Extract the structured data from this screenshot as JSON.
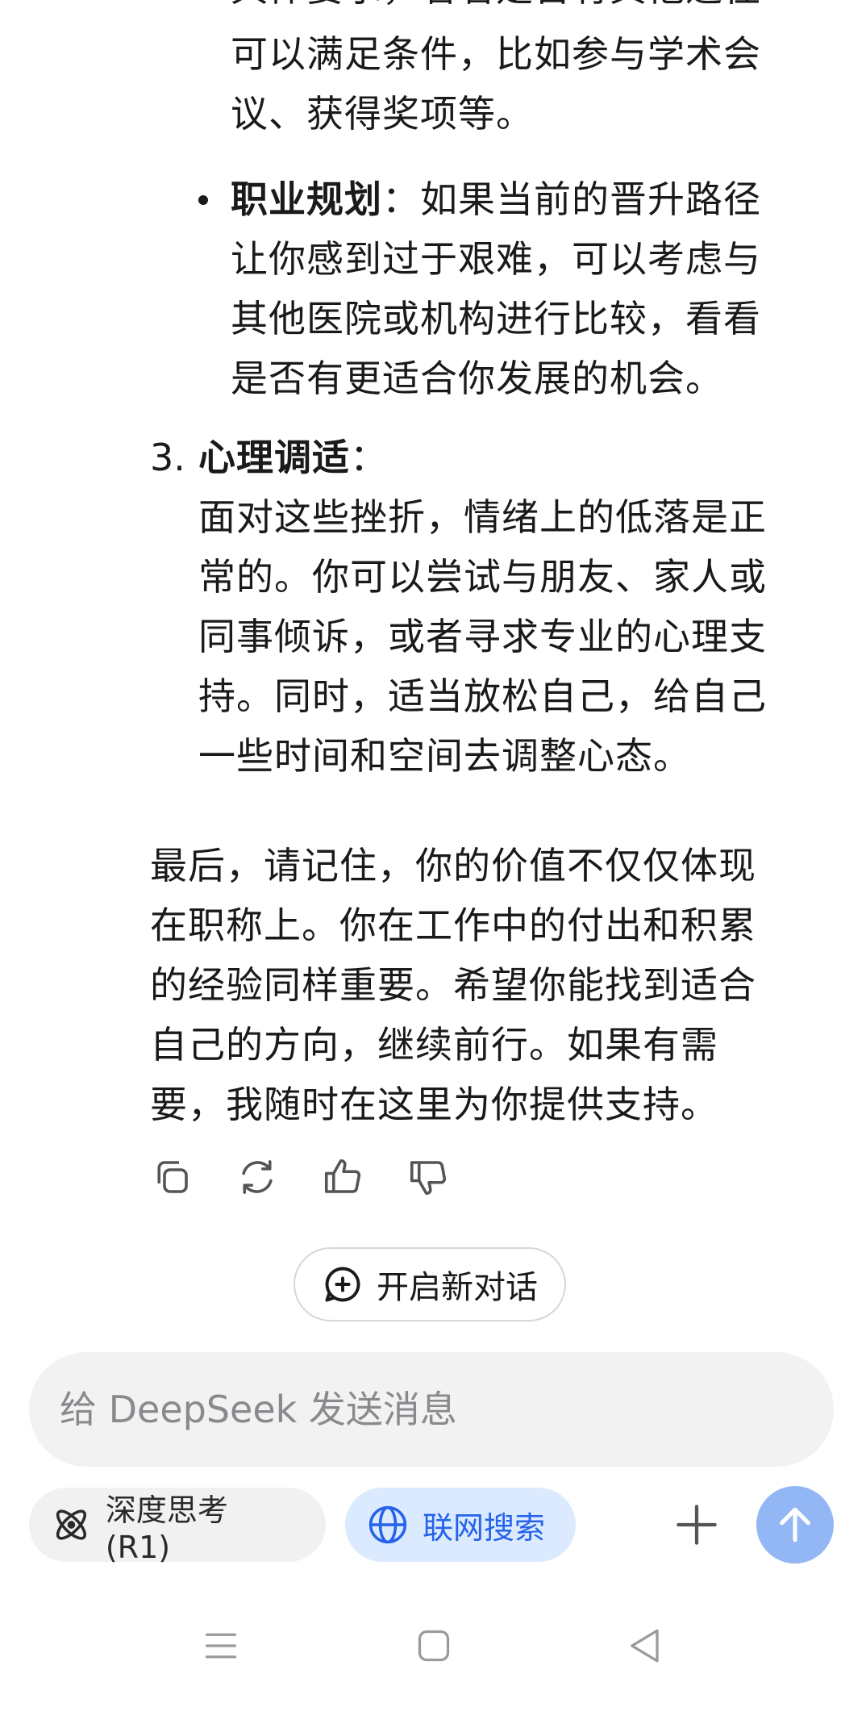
{
  "message": {
    "clipped_top_line": "具体要求，看看是否有其他途径",
    "lines_block1": [
      "可以满足条件，比如参与学术会",
      "议、获得奖项等。"
    ],
    "bullet": {
      "title": "职业规划",
      "sep": "：",
      "first_line_rest": "如果当前的晋升路径",
      "lines": [
        "让你感到过于艰难，可以考虑与",
        "其他医院或机构进行比较，看看",
        "是否有更适合你发展的机会。"
      ]
    },
    "section3": {
      "number": "3.",
      "title": "心理调适",
      "sep": "：",
      "lines": [
        "面对这些挫折，情绪上的低落是正",
        "常的。你可以尝试与朋友、家人或",
        "同事倾诉，或者寻求专业的心理支",
        "持。同时，适当放松自己，给自己",
        "一些时间和空间去调整心态。"
      ]
    },
    "closing_lines": [
      "最后，请记住，你的价值不仅仅体现",
      "在职称上。你在工作中的付出和积累",
      "的经验同样重要。希望你能找到适合",
      "自己的方向，继续前行。如果有需",
      "要，我随时在这里为你提供支持。"
    ]
  },
  "actions": [
    "copy-icon",
    "regenerate-icon",
    "thumbs-up-icon",
    "thumbs-down-icon"
  ],
  "new_chat": {
    "label": "开启新对话"
  },
  "input": {
    "placeholder": "给 DeepSeek 发送消息",
    "value": ""
  },
  "controls": {
    "deep_think_label": "深度思考 (R1)",
    "web_search_label": "联网搜索",
    "web_search_active": true
  },
  "colors": {
    "accent": "#2563eb",
    "chip_active_bg": "#dbeafe",
    "send_button": "#93b7f5",
    "input_bg": "#f2f2f3"
  }
}
